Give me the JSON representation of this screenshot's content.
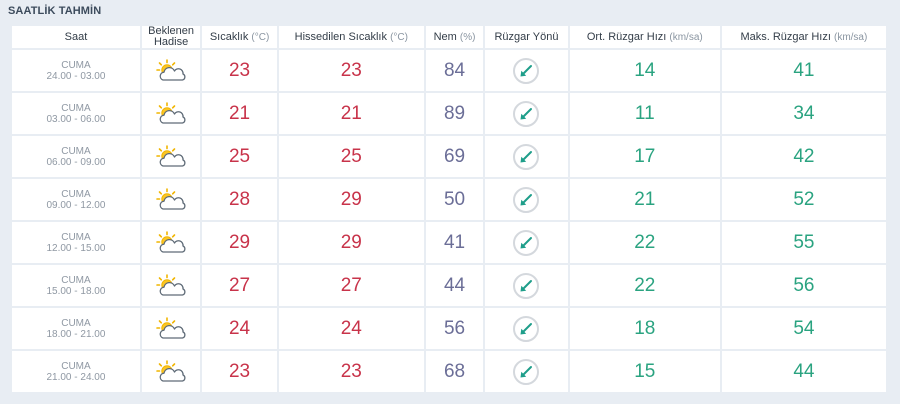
{
  "page": {
    "title": "SAATLİK TAHMİN"
  },
  "headers": {
    "time": "Saat",
    "condition_line1": "Beklenen",
    "condition_line2": "Hadise",
    "temp": "Sıcaklık",
    "temp_unit": "(°C)",
    "feels": "Hissedilen Sıcaklık",
    "feels_unit": "(°C)",
    "humidity": "Nem",
    "humidity_unit": "(%)",
    "wind_dir": "Rüzgar Yönü",
    "wind_avg": "Ort. Rüzgar Hızı",
    "wind_avg_unit": "(km/sa)",
    "wind_max": "Maks. Rüzgar Hızı",
    "wind_max_unit": "(km/sa)"
  },
  "colors": {
    "temp": "#c8334a",
    "humidity": "#6b6e97",
    "wind": "#2aa380",
    "arrow": "#1e9e8a"
  },
  "rows": [
    {
      "day": "CUMA",
      "range": "24.00 - 03.00",
      "condition_icon": "partly-cloudy-icon",
      "temp": "23",
      "feels": "23",
      "humidity": "84",
      "wind_dir_icon": "arrow-southwest-icon",
      "wind_avg": "14",
      "wind_max": "41"
    },
    {
      "day": "CUMA",
      "range": "03.00 - 06.00",
      "condition_icon": "partly-cloudy-icon",
      "temp": "21",
      "feels": "21",
      "humidity": "89",
      "wind_dir_icon": "arrow-southwest-icon",
      "wind_avg": "11",
      "wind_max": "34"
    },
    {
      "day": "CUMA",
      "range": "06.00 - 09.00",
      "condition_icon": "partly-cloudy-icon",
      "temp": "25",
      "feels": "25",
      "humidity": "69",
      "wind_dir_icon": "arrow-southwest-icon",
      "wind_avg": "17",
      "wind_max": "42"
    },
    {
      "day": "CUMA",
      "range": "09.00 - 12.00",
      "condition_icon": "partly-cloudy-icon",
      "temp": "28",
      "feels": "29",
      "humidity": "50",
      "wind_dir_icon": "arrow-southwest-icon",
      "wind_avg": "21",
      "wind_max": "52"
    },
    {
      "day": "CUMA",
      "range": "12.00 - 15.00",
      "condition_icon": "partly-cloudy-icon",
      "temp": "29",
      "feels": "29",
      "humidity": "41",
      "wind_dir_icon": "arrow-southwest-icon",
      "wind_avg": "22",
      "wind_max": "55"
    },
    {
      "day": "CUMA",
      "range": "15.00 - 18.00",
      "condition_icon": "partly-cloudy-icon",
      "temp": "27",
      "feels": "27",
      "humidity": "44",
      "wind_dir_icon": "arrow-southwest-icon",
      "wind_avg": "22",
      "wind_max": "56"
    },
    {
      "day": "CUMA",
      "range": "18.00 - 21.00",
      "condition_icon": "partly-cloudy-icon",
      "temp": "24",
      "feels": "24",
      "humidity": "56",
      "wind_dir_icon": "arrow-southwest-icon",
      "wind_avg": "18",
      "wind_max": "54"
    },
    {
      "day": "CUMA",
      "range": "21.00 - 24.00",
      "condition_icon": "partly-cloudy-icon",
      "temp": "23",
      "feels": "23",
      "humidity": "68",
      "wind_dir_icon": "arrow-southwest-icon",
      "wind_avg": "15",
      "wind_max": "44"
    }
  ]
}
